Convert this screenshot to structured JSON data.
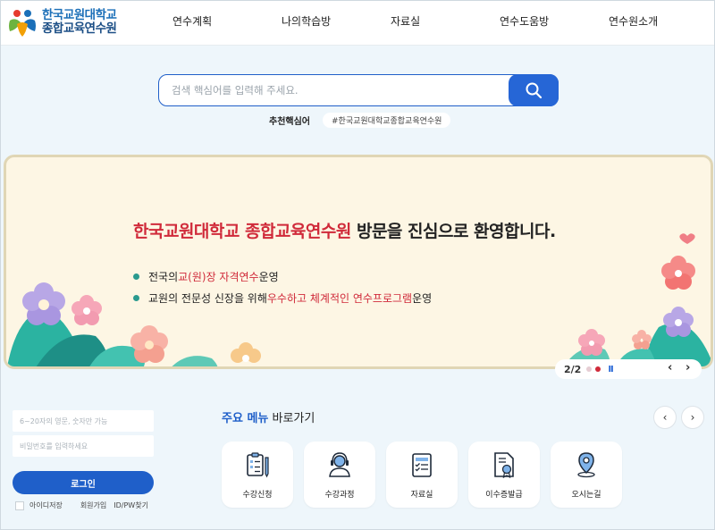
{
  "header": {
    "logo_line1": "한국교원대학교",
    "logo_line2": "종합교육연수원",
    "nav": [
      "연수계획",
      "나의학습방",
      "자료실",
      "연수도움방",
      "연수원소개"
    ]
  },
  "search": {
    "placeholder": "검색 핵심어를 입력해 주세요.",
    "recommend_label": "추천핵심어",
    "recommend_tag": "#한국교원대학교종합교육연수원"
  },
  "banner": {
    "title_red": "한국교원대학교 종합교육연수원",
    "title_dark": " 방문을 진심으로 환영합니다.",
    "bullet1_pre": "전국의 ",
    "bullet1_hl": "교(원)장 자격연수",
    "bullet1_post": " 운영",
    "bullet2_pre": "교원의 전문성 신장을 위해 ",
    "bullet2_hl": "우수하고 체계적인 연수프로그램",
    "bullet2_post": " 운영",
    "pager": "2/2",
    "pause": "II",
    "prev": "‹",
    "next": "›"
  },
  "login": {
    "id_placeholder": "6~20자의 영문, 숫자만 가능",
    "pw_placeholder": "비밀번호를 입력하세요",
    "button": "로그인",
    "save_id": "아이디저장",
    "join": "회원가입",
    "find": "ID/PW찾기"
  },
  "menu": {
    "title_bold": "주요 메뉴",
    "title_normal": " 바로가기",
    "prev": "‹",
    "next": "›",
    "items": [
      {
        "label": "수강신청",
        "icon": "clipboard-pen-icon"
      },
      {
        "label": "수강과정",
        "icon": "headset-person-icon"
      },
      {
        "label": "자료실",
        "icon": "checklist-icon"
      },
      {
        "label": "이수증발급",
        "icon": "certificate-icon"
      },
      {
        "label": "오시는길",
        "icon": "map-pin-icon"
      }
    ]
  },
  "colors": {
    "brand_blue": "#1f5fc9",
    "accent_red": "#d02a3a",
    "bullet_teal": "#2a9a8e",
    "banner_bg": "#fdf6e4"
  }
}
